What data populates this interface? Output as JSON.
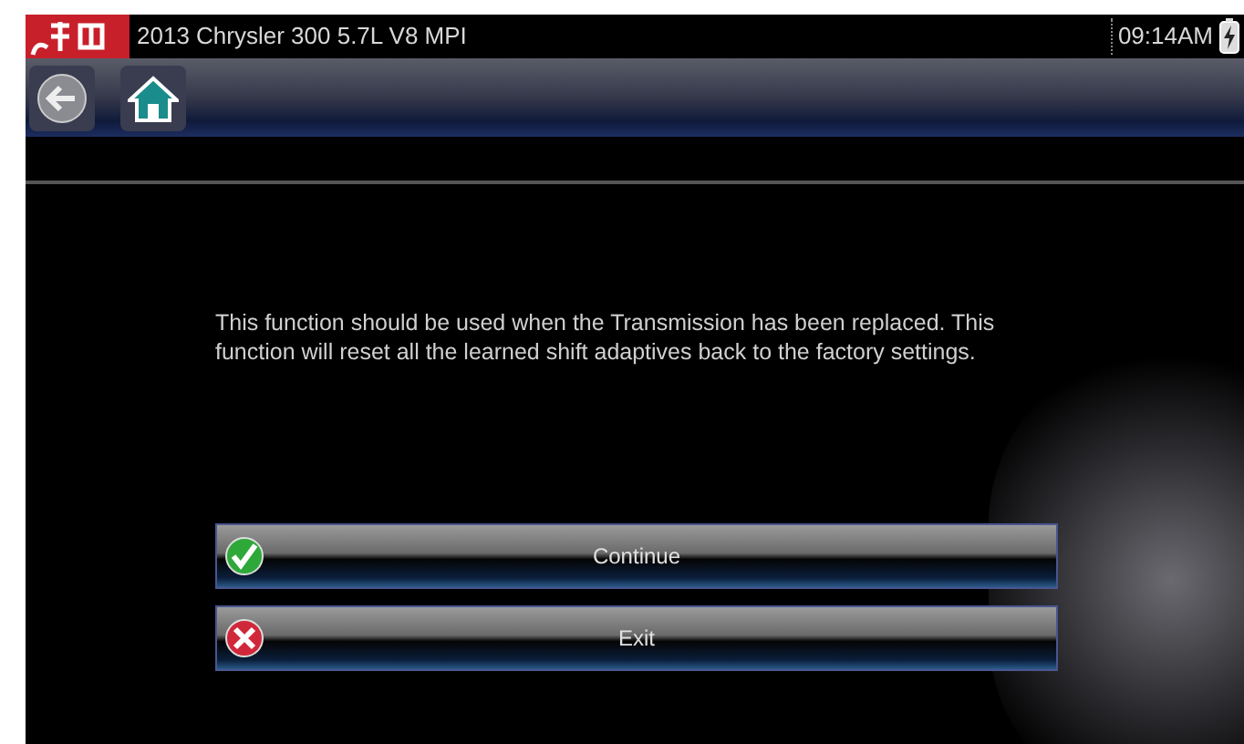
{
  "title_bar": {
    "vehicle": "2013 Chrysler 300 5.7L V8 MPI",
    "time": "09:14AM"
  },
  "message": "This function should be used when the Transmission has been replaced. This function will reset all the learned shift adaptives back to the factory settings.",
  "buttons": [
    {
      "label": "Continue",
      "kind": "continue"
    },
    {
      "label": "Exit",
      "kind": "exit"
    }
  ]
}
